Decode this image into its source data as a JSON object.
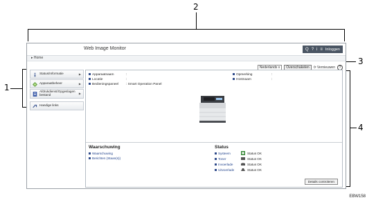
{
  "callouts": {
    "one": "1",
    "two": "2",
    "three": "3",
    "four": "4"
  },
  "app": {
    "name": "Web Image Monitor"
  },
  "header": {
    "search_icon": "Q",
    "help_icon": "?",
    "info_icon": "i",
    "logout_label": "Inloggen"
  },
  "breadcrumb": {
    "home": "Home"
  },
  "toolbar": {
    "language": "Nederlands",
    "language_chevron": "v",
    "overview_label": "Overschakelen",
    "refresh_label": "Vernieuwen",
    "help_icon": "?"
  },
  "sidebar": {
    "items": [
      {
        "label": "Status/Informatie",
        "icon": "info-icon"
      },
      {
        "label": "Apparaatbeheer",
        "icon": "device-icon"
      },
      {
        "label": "Afdrukdienst/Opgeslagen bestand",
        "icon": "document-icon"
      },
      {
        "label": "Handige links",
        "icon": "link-icon"
      }
    ]
  },
  "device_info": {
    "name_label": "Apparaatnaam",
    "name_value": ":",
    "location_label": "Locatie",
    "location_value": ":",
    "panel_label": "Bedieningspaneel",
    "panel_value": ": Smart Operation Panel",
    "comment_label": "Opmerking",
    "comment_value": ":",
    "host_label": "Hostnaam",
    "host_value": ":"
  },
  "alerts": {
    "title": "Waarschuwing",
    "items": [
      "Waarschuwing",
      "Berichten (Staan(s))"
    ]
  },
  "status": {
    "title": "Status",
    "rows": [
      {
        "label": "Systeem",
        "value": "Status OK"
      },
      {
        "label": "Toner",
        "value": "Status OK"
      },
      {
        "label": "Invoerlade",
        "value": "Status OK"
      },
      {
        "label": "Uitvoerlade",
        "value": "Status OK"
      }
    ],
    "details_button": "Details controleren"
  },
  "figure_code": "EBW158"
}
